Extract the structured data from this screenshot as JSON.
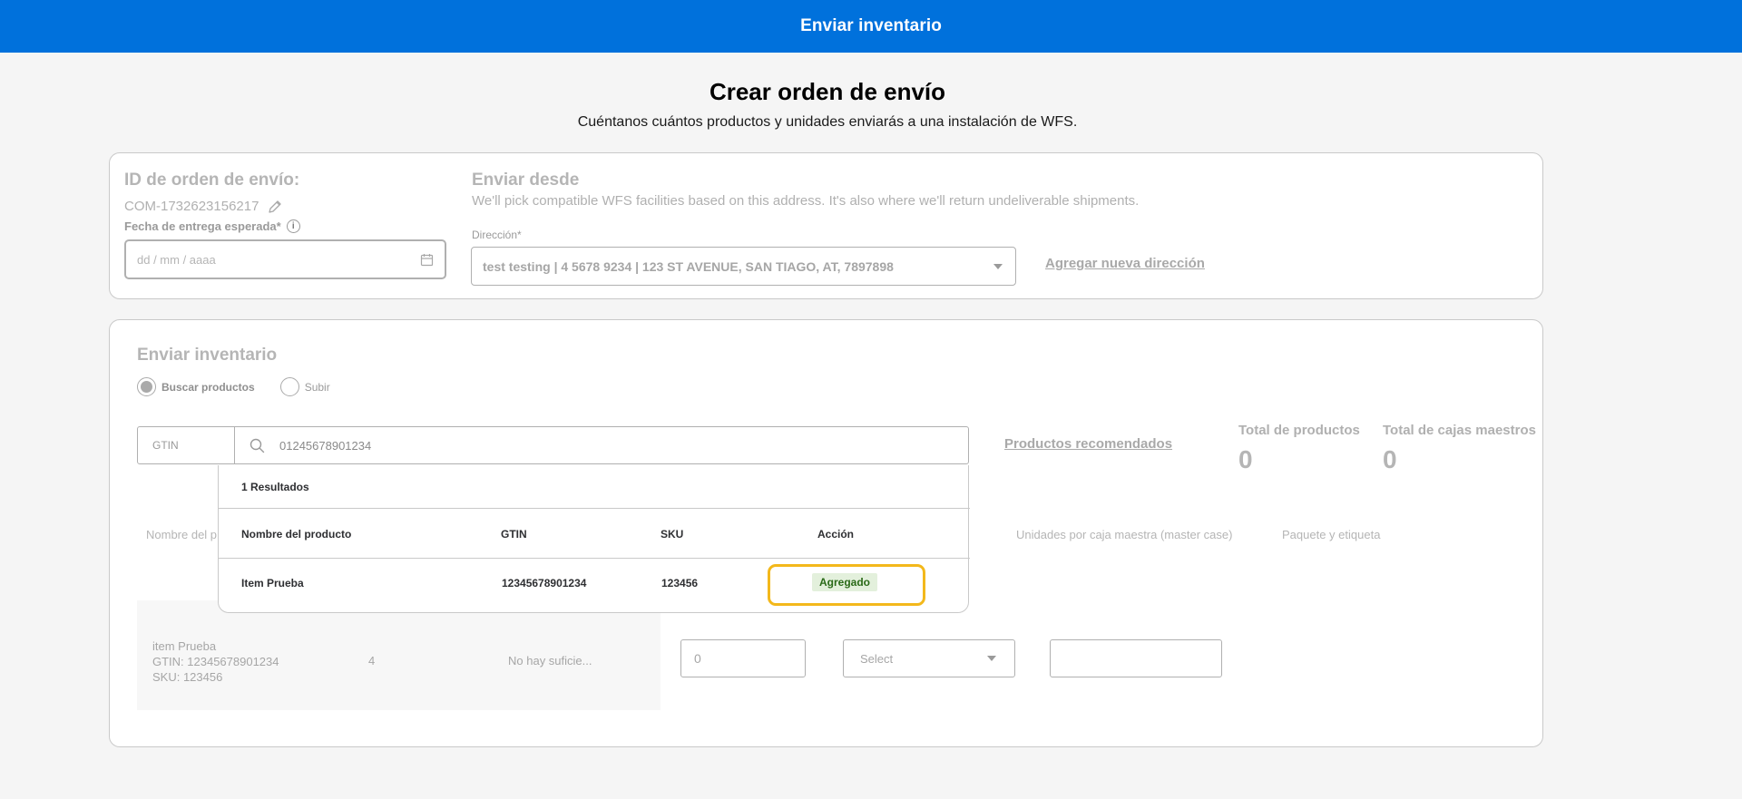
{
  "topbar": {
    "title": "Enviar inventario"
  },
  "page": {
    "title": "Crear orden de envío",
    "subtitle": "Cuéntanos cuántos productos y unidades enviarás a una instalación de WFS."
  },
  "order": {
    "id_heading": "ID de orden de envío:",
    "id_value": "COM-1732623156217",
    "date_label": "Fecha de entrega esperada*",
    "date_placeholder": "dd / mm / aaaa"
  },
  "ship_from": {
    "heading": "Enviar desde",
    "description": "We'll pick compatible WFS facilities based on this address. It's also where we'll return undeliverable shipments.",
    "address_label": "Dirección*",
    "address_value": "test testing | 4 5678 9234 | 123 ST AVENUE, SAN TIAGO, AT, 7897898",
    "add_address_link": "Agregar nueva dirección"
  },
  "inventory": {
    "heading": "Enviar inventario",
    "radio_search": "Buscar productos",
    "radio_upload": "Subir",
    "search_type": "GTIN",
    "search_value": "01245678901234",
    "recommended_link": "Productos recomendados",
    "total_products_label": "Total de productos",
    "total_products_value": "0",
    "total_cases_label": "Total de cajas maestros",
    "total_cases_value": "0",
    "columns": {
      "name": "Nombre del p",
      "units_per_case": "Unidades por caja maestra (master case)",
      "pack_label": "Paquete y etiqueta"
    },
    "row": {
      "name_line": "item Prueba",
      "gtin_line": "GTIN: 12345678901234",
      "sku_line": "SKU: 123456",
      "qty": "4",
      "status": "No hay suficie...",
      "units_input": "0",
      "select_value": "Select"
    }
  },
  "results": {
    "count": "1 Resultados",
    "headers": [
      "Nombre del producto",
      "GTIN",
      "SKU",
      "Acción"
    ],
    "rows": [
      {
        "name": "Item Prueba",
        "gtin": "12345678901234",
        "sku": "123456",
        "action": "Agregado"
      }
    ]
  },
  "colors": {
    "topbar": "#0071dc",
    "highlight": "#f3b81b",
    "badge_bg": "#e3f0dc",
    "badge_text": "#2a6a18"
  }
}
